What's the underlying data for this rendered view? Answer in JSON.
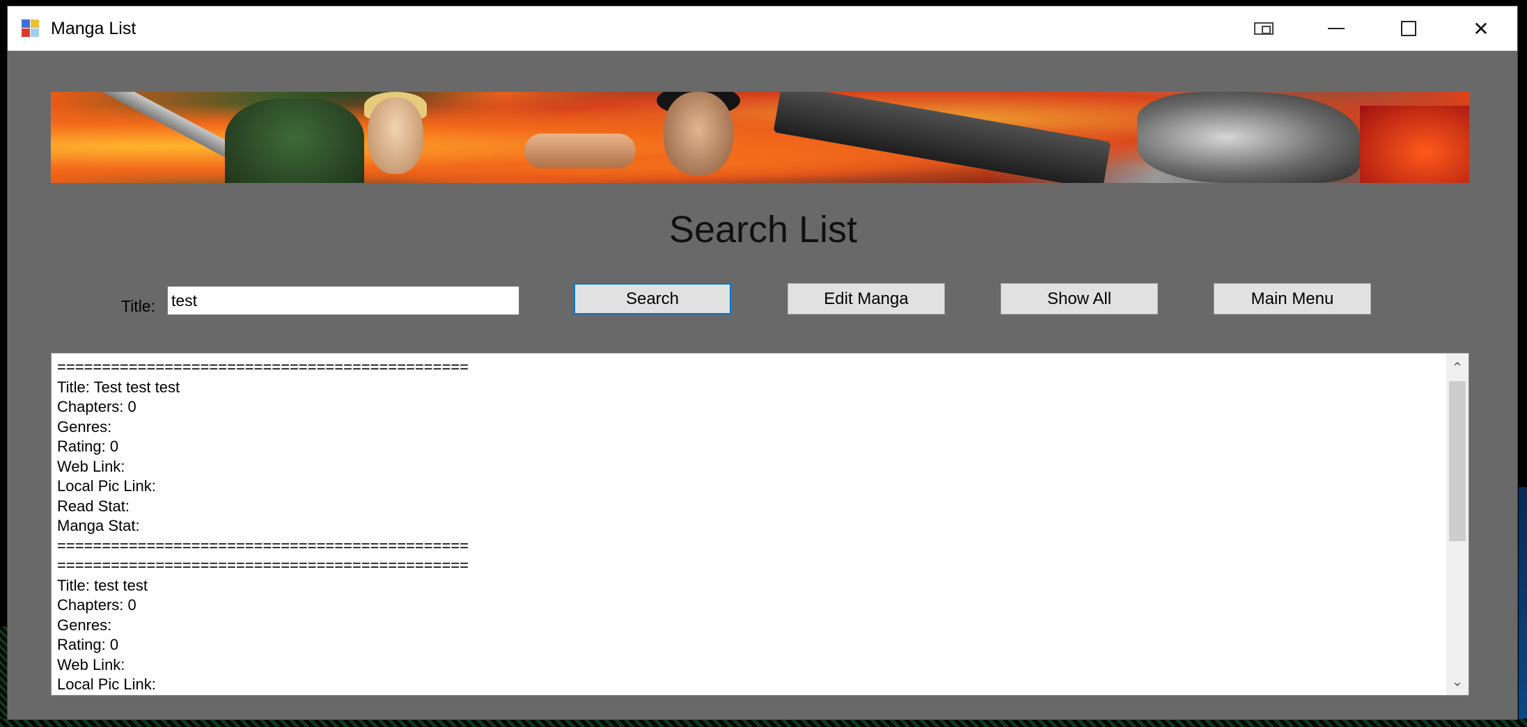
{
  "window": {
    "title": "Manga List",
    "controls": [
      "pip-icon",
      "minimize-icon",
      "maximize-icon",
      "close-icon"
    ],
    "close_glyph": "✕"
  },
  "page": {
    "heading": "Search List"
  },
  "search": {
    "label": "Title:",
    "value": "test"
  },
  "buttons": {
    "search": "Search",
    "edit": "Edit Manga",
    "show_all": "Show All",
    "main_menu": "Main Menu"
  },
  "output": {
    "lines": [
      "==============================================",
      "Title: Test test test",
      "Chapters: 0",
      "Genres:",
      "Rating: 0",
      "Web Link:",
      "Local Pic Link:",
      "Read Stat:",
      "Manga Stat:",
      "==============================================",
      "==============================================",
      "Title: test test",
      "Chapters: 0",
      "Genres:",
      "Rating: 0",
      "Web Link:",
      "Local Pic Link:"
    ],
    "scroll_up_glyph": "⌃",
    "scroll_down_glyph": "⌄"
  },
  "colors": {
    "window_bg": "#696969",
    "focus_accent": "#0078d7"
  }
}
